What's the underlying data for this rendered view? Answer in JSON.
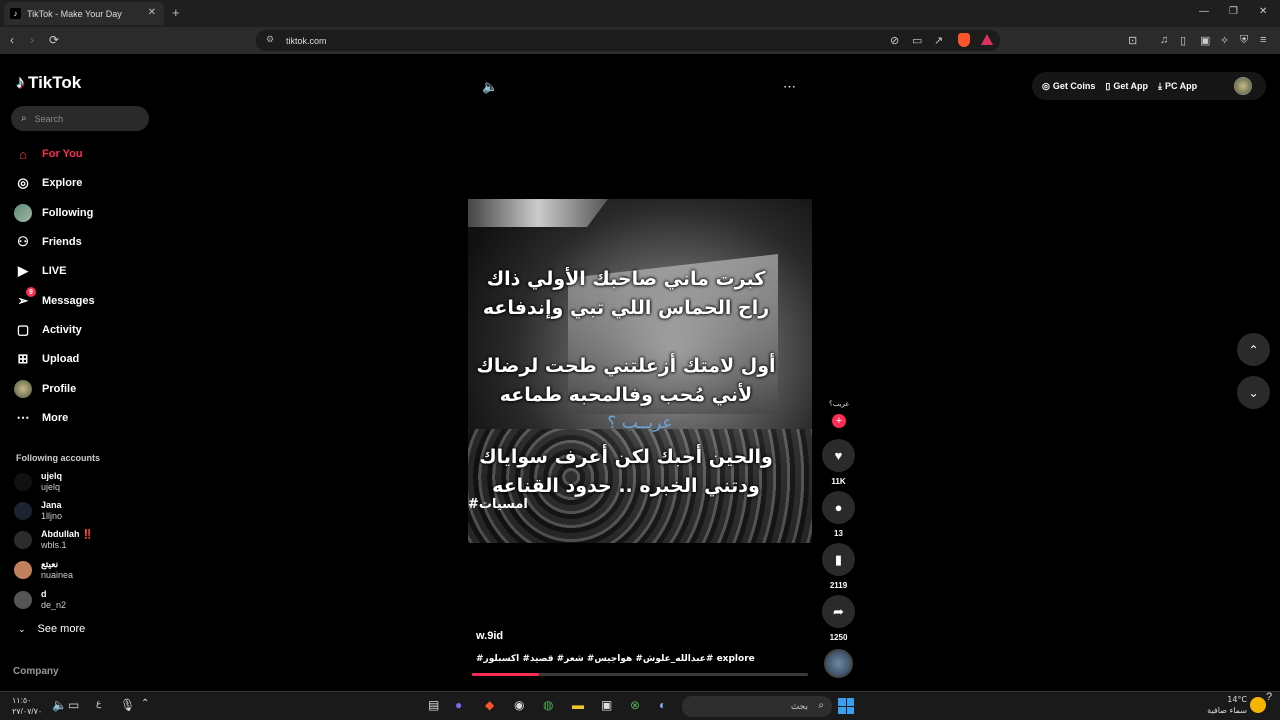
{
  "browser": {
    "tab_title": "TikTok - Make Your Day",
    "url": "tiktok.com"
  },
  "sidebar": {
    "logo": "TikTok",
    "search_placeholder": "Search",
    "nav": [
      {
        "label": "For You",
        "icon": "home-icon"
      },
      {
        "label": "Explore",
        "icon": "compass-icon"
      },
      {
        "label": "Following",
        "icon": "avatar-icon"
      },
      {
        "label": "Friends",
        "icon": "friends-icon"
      },
      {
        "label": "LIVE",
        "icon": "live-icon"
      },
      {
        "label": "Messages",
        "icon": "paper-plane-icon",
        "badge": "9"
      },
      {
        "label": "Activity",
        "icon": "activity-icon"
      },
      {
        "label": "Upload",
        "icon": "upload-icon"
      },
      {
        "label": "Profile",
        "icon": "avatar-icon"
      },
      {
        "label": "More",
        "icon": "more-dots-icon"
      }
    ],
    "following_title": "Following accounts",
    "accounts": [
      {
        "name": "ujelq",
        "handle": "ujelq"
      },
      {
        "name": "Jana",
        "handle": "1lljno"
      },
      {
        "name": "Abdullah ‼️",
        "handle": "wbls.1"
      },
      {
        "name": "نعيتع",
        "handle": "nuainea"
      },
      {
        "name": "d",
        "handle": "de_n2"
      }
    ],
    "see_more": "See more",
    "company": "Company"
  },
  "header": {
    "get_coins": "Get Coins",
    "get_app": "Get App",
    "pc_app": "PC App"
  },
  "video": {
    "lyrics": [
      "كبرت ماني صاحبك الأولي ذاك",
      "راح الحماس اللي تبي وإندفاعه",
      "أول لامتك أزعلتني طحت لرضاك",
      "لأني مُحب وفالمحبه طماعه",
      "والحين أحبك لكن أعرف سواياك",
      "ودتني الخبره .. حدود القناعه"
    ],
    "blue_text": "عريــب ؟",
    "watermark": "#امسيات",
    "author": "w.9id",
    "caption": "#عبدالله_علوش# هواجيس# شعر# قصيد# اكسبلور# explore",
    "creator_tag": "عريب؟",
    "progress": 0.2
  },
  "actions": {
    "likes": "11K",
    "comments": "13",
    "saves": "2119",
    "shares": "1250"
  },
  "taskbar": {
    "time": "١١:٥٠",
    "date": "٢٧/٠٧/٧٠",
    "search_placeholder": "بحث",
    "temp": "14°C",
    "weather": "سماء صافية"
  },
  "colors": {
    "accent": "#fe2c55",
    "background": "#000000"
  }
}
